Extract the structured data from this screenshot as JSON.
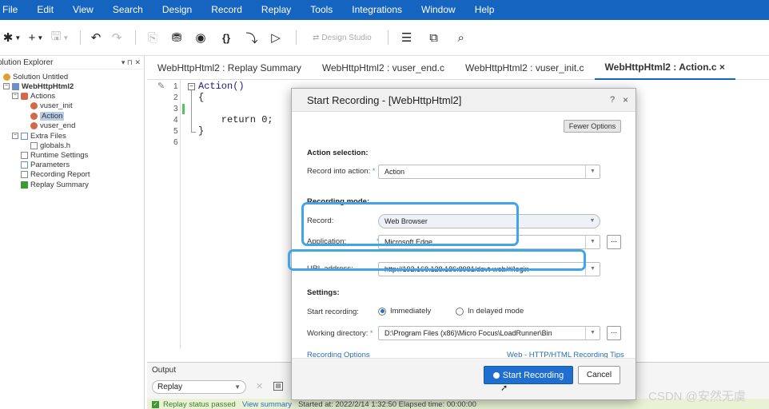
{
  "menu": [
    "File",
    "Edit",
    "View",
    "Search",
    "Design",
    "Record",
    "Replay",
    "Tools",
    "Integrations",
    "Window",
    "Help"
  ],
  "toolbar": {
    "design_studio_label": "Design Studio"
  },
  "explorer": {
    "title": "olution Explorer",
    "pin_glyph": "▾ ⊓ ✕",
    "items": [
      "Solution Untitled",
      "WebHttpHtml2",
      "Actions",
      "vuser_init",
      "Action",
      "vuser_end",
      "Extra Files",
      "globals.h",
      "Runtime Settings",
      "Parameters",
      "Recording Report",
      "Replay Summary"
    ]
  },
  "tabs": [
    "WebHttpHtml2 : Replay Summary",
    "WebHttpHtml2 : vuser_end.c",
    "WebHttpHtml2 : vuser_init.c",
    "WebHttpHtml2 : Action.c"
  ],
  "tab_close": "×",
  "editor": {
    "line_numbers": [
      "1",
      "2",
      "3",
      "4",
      "5",
      "6"
    ],
    "lines": [
      "Action()",
      "{",
      "",
      "    return 0;",
      "}",
      ""
    ]
  },
  "output": {
    "title": "Output",
    "filter": "Replay",
    "status_passed": "Replay status passed",
    "view_summary": "View summary",
    "run_info": "Started at: 2022/2/14 1:32:50 Elapsed time: 00:00:00"
  },
  "dialog": {
    "title": "Start Recording - [WebHttpHtml2]",
    "help": "?",
    "close": "×",
    "fewer_options": "Fewer Options",
    "action_selection_header": "Action selection:",
    "record_into_label": "Record into action:",
    "record_into_value": "Action",
    "recording_mode_header": "Recording mode:",
    "record_label": "Record:",
    "record_value": "Web Browser",
    "application_label": "Application:",
    "application_value": "Microsoft Edge",
    "url_label": "URL address:",
    "url_value": "http://192.168.128.186:8981/devt-web/#/login",
    "settings_header": "Settings:",
    "start_recording_label": "Start recording:",
    "immediately": "Immediately",
    "delayed_mode": "In delayed mode",
    "working_dir_label": "Working directory:",
    "working_dir_value": "D:\\Program Files (x86)\\Micro Focus\\LoadRunner\\Bin",
    "recording_options_link": "Recording Options",
    "tips_link": "Web - HTTP/HTML Recording Tips",
    "start_button": "Start Recording",
    "cancel_button": "Cancel",
    "required_mark": "*",
    "browse": "..."
  },
  "watermark": "CSDN @安然无虞",
  "colors": {
    "accent": "#1565c0",
    "highlight": "#41a6e8",
    "status_ok": "#3f9a35"
  }
}
